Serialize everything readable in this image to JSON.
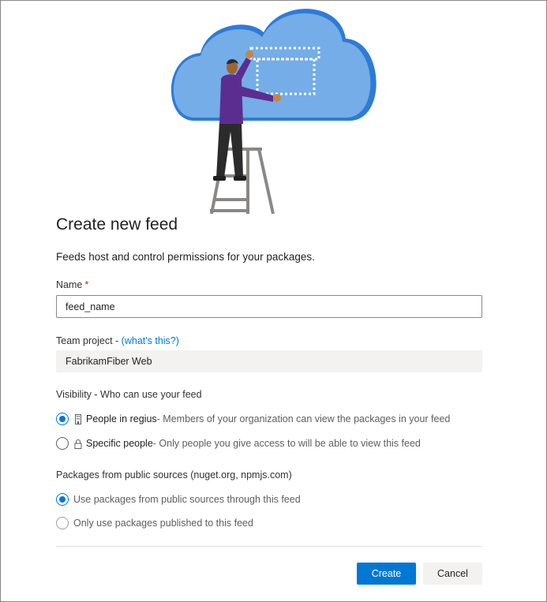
{
  "dialog": {
    "title": "Create new feed",
    "subtitle": "Feeds host and control permissions for your packages."
  },
  "name_field": {
    "label": "Name",
    "required_marker": "*",
    "value": "feed_name"
  },
  "team_project": {
    "label": "Team project - ",
    "help_link": "(what's this?)",
    "value": "FabrikamFiber Web"
  },
  "visibility": {
    "label": "Visibility - Who can use your feed",
    "options": [
      {
        "title": "People in regius",
        "description": " - Members of your organization can view the packages in your feed",
        "icon": "building-icon",
        "selected": true
      },
      {
        "title": "Specific people",
        "description": " - Only people you give access to will be able to view this feed",
        "icon": "lock-icon",
        "selected": false
      }
    ]
  },
  "upstream": {
    "label": "Packages from public sources (nuget.org, npmjs.com)",
    "options": [
      {
        "label": "Use packages from public sources through this feed",
        "selected": true
      },
      {
        "label": "Only use packages published to this feed",
        "selected": false
      }
    ]
  },
  "buttons": {
    "create": "Create",
    "cancel": "Cancel"
  },
  "colors": {
    "accent": "#0078d4",
    "cloud": "#74ade8",
    "cloud_edge": "#2e7bd6",
    "shirt": "#5c2d91"
  }
}
